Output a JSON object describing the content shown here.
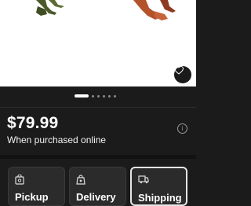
{
  "product": {
    "price": "$79.99",
    "price_note": "When purchased online",
    "carousel": {
      "total_images": 6,
      "active_index": 0
    }
  },
  "icons": {
    "favorite": "heart-outline-icon",
    "info": "info-icon",
    "pickup": "store-bag-icon",
    "delivery": "delivery-bag-icon",
    "shipping": "truck-icon"
  },
  "fulfillment": {
    "options": [
      {
        "label": "Pickup",
        "selected": false
      },
      {
        "label": "Delivery",
        "selected": false
      },
      {
        "label": "Shipping",
        "selected": true
      }
    ]
  },
  "colors": {
    "background": "#1b1b1b",
    "card": "#2b2b2b",
    "selected_border": "#e6e6e6"
  }
}
